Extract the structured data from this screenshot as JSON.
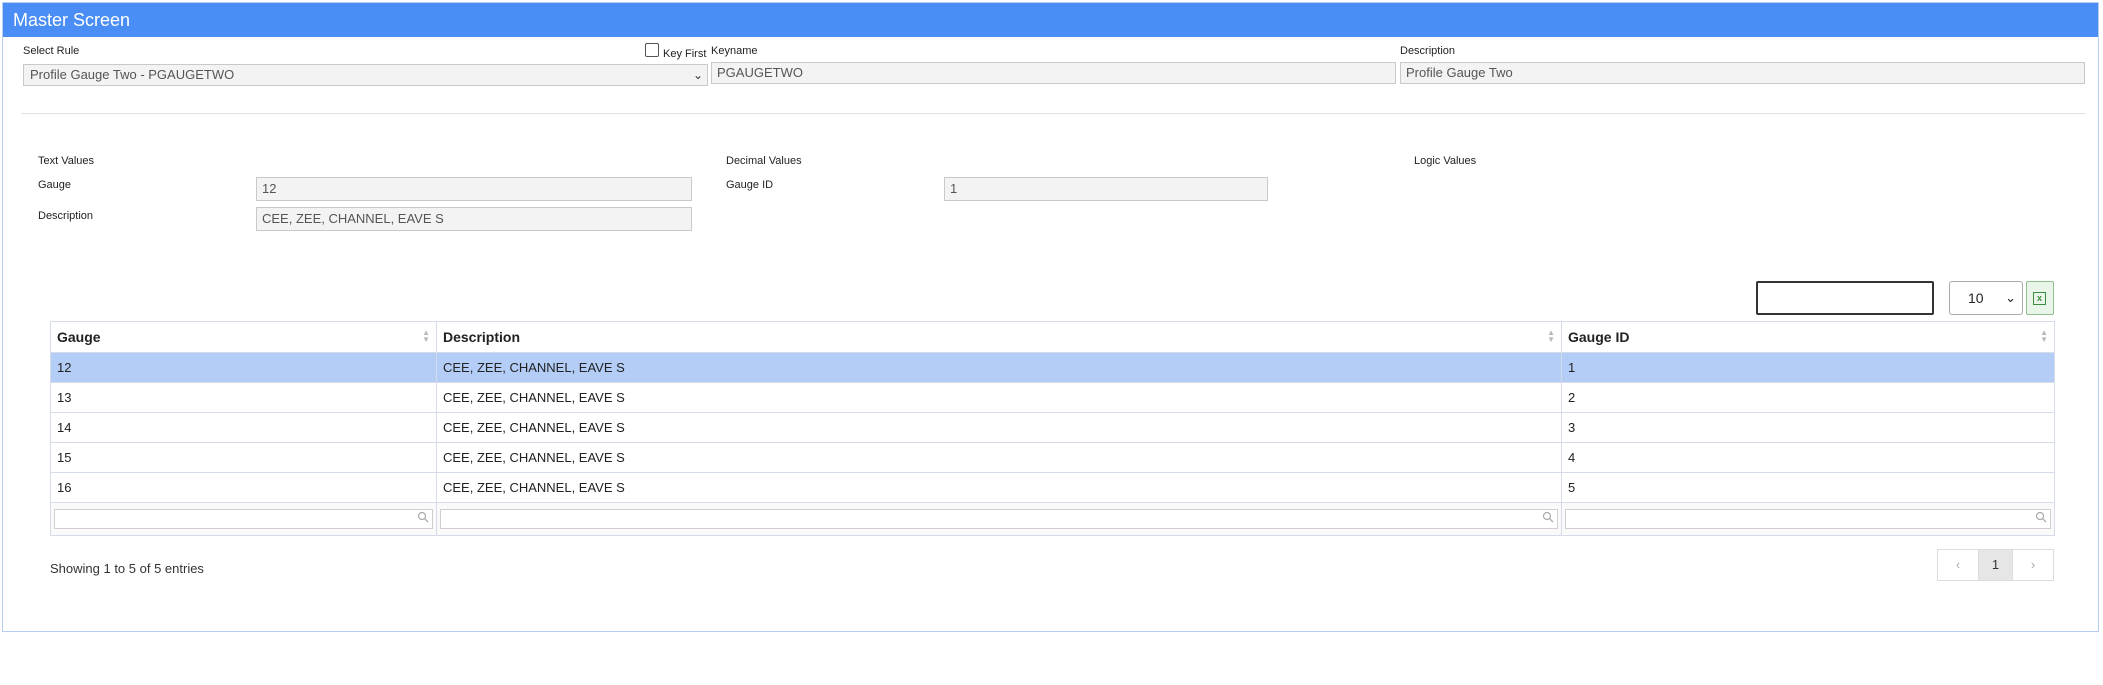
{
  "title": "Master Screen",
  "header": {
    "select_rule_label": "Select Rule",
    "select_rule_value": "Profile Gauge Two - PGAUGETWO",
    "key_first_label": "Key First",
    "keyname_label": "Keyname",
    "keyname_value": "PGAUGETWO",
    "description_label": "Description",
    "description_value": "Profile Gauge Two"
  },
  "sections": {
    "text_values": "Text Values",
    "decimal_values": "Decimal Values",
    "logic_values": "Logic Values"
  },
  "text_fields": {
    "gauge_label": "Gauge",
    "gauge_value": "12",
    "description_label": "Description",
    "description_value": "CEE, ZEE, CHANNEL, EAVE S"
  },
  "decimal_fields": {
    "gauge_id_label": "Gauge ID",
    "gauge_id_value": "1"
  },
  "table": {
    "page_length": "10",
    "columns": [
      "Gauge",
      "Description",
      "Gauge ID"
    ],
    "rows": [
      [
        "12",
        "CEE, ZEE, CHANNEL, EAVE S",
        "1"
      ],
      [
        "13",
        "CEE, ZEE, CHANNEL, EAVE S",
        "2"
      ],
      [
        "14",
        "CEE, ZEE, CHANNEL, EAVE S",
        "3"
      ],
      [
        "15",
        "CEE, ZEE, CHANNEL, EAVE S",
        "4"
      ],
      [
        "16",
        "CEE, ZEE, CHANNEL, EAVE S",
        "5"
      ]
    ],
    "selected_row": 0
  },
  "footer": {
    "info": "Showing 1 to 5 of 5 entries",
    "prev": "‹",
    "page": "1",
    "next": "›"
  },
  "icons": {
    "excel": "excel-export-icon",
    "search": "search-icon",
    "sort": "sort-icon",
    "dropdown": "chevron-down-icon"
  }
}
